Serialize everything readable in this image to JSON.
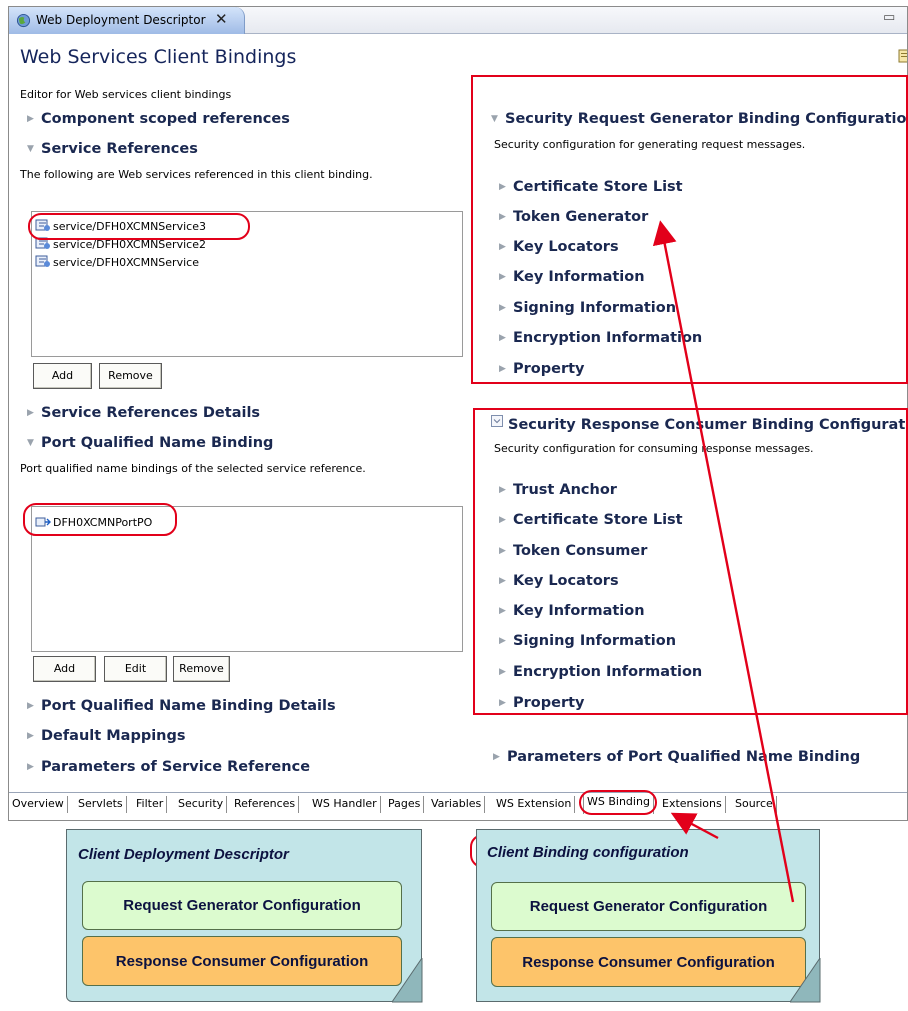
{
  "editor": {
    "tab_title": "Web Deployment Descriptor",
    "tab_close_glyph": "✕",
    "view_controls_glyph": "▭",
    "page_title": "Web Services Client Bindings",
    "editor_description": "Editor for Web services client bindings"
  },
  "left": {
    "component_scoped_references": "Component scoped references",
    "service_references": {
      "title": "Service References",
      "description": "The following are Web services referenced in this client binding.",
      "items": [
        "service/DFH0XCMNService3",
        "service/DFH0XCMNService2",
        "service/DFH0XCMNService"
      ],
      "buttons": [
        "Add",
        "Remove"
      ]
    },
    "service_references_details": "Service References Details",
    "port_qualified_name_binding": {
      "title": "Port Qualified Name Binding",
      "description": "Port qualified name bindings of the selected service reference.",
      "items": [
        "DFH0XCMNPortPO"
      ],
      "buttons": [
        "Add",
        "Edit",
        "Remove"
      ]
    },
    "port_qualified_name_binding_details": "Port Qualified Name Binding Details",
    "default_mappings": "Default Mappings",
    "parameters_of_service_reference": "Parameters of Service Reference"
  },
  "right": {
    "request_generator": {
      "title": "Security Request Generator Binding Configuration",
      "description": "Security configuration for generating request messages.",
      "items": [
        "Certificate Store List",
        "Token Generator",
        "Key Locators",
        "Key Information",
        "Signing Information",
        "Encryption Information",
        "Property"
      ]
    },
    "response_consumer": {
      "title": "Security Response Consumer Binding Configuration",
      "description": "Security configuration for consuming response messages.",
      "items": [
        "Trust Anchor",
        "Certificate Store List",
        "Token Consumer",
        "Key Locators",
        "Key Information",
        "Signing Information",
        "Encryption Information",
        "Property"
      ]
    },
    "parameters_of_port_qualified_name_binding": "Parameters of Port Qualified Name Binding"
  },
  "bottom_tabs": [
    "Overview",
    "Servlets",
    "Filter",
    "Security",
    "References",
    "WS Handler",
    "Pages",
    "Variables",
    "WS Extension",
    "WS Binding",
    "Extensions",
    "Source"
  ],
  "notes": {
    "left": {
      "title": "Client Deployment Descriptor",
      "cards": [
        "Request Generator Configuration",
        "Response Consumer Configuration"
      ]
    },
    "right": {
      "title": "Client Binding configuration",
      "cards": [
        "Request Generator Configuration",
        "Response Consumer Configuration"
      ]
    }
  },
  "colors": {
    "highlight": "#e2001a",
    "section_text": "#1a2850",
    "note_bg": "#c2e5e8",
    "card_green": "#dcfbcf",
    "card_orange": "#fdc46a"
  }
}
